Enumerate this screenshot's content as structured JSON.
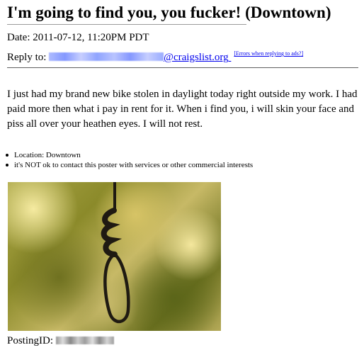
{
  "posting": {
    "title": "I'm going to find you, you fucker! (Downtown)",
    "date_label": "Date:",
    "date_value": "2011-07-12, 11:20PM PDT",
    "reply_label": "Reply to:",
    "reply_domain": "@craigslist.org",
    "errors_link": "[Errors when replying to ads?]",
    "body": "I just had my brand new bike stolen in daylight today right outside my work. I had paid more then what i pay in rent for it. When i find you, i will skin your face and piss all over your heathen eyes. I will not rest.",
    "details": [
      {
        "text": "Location: Downtown"
      },
      {
        "text": "it's NOT ok to contact this poster with services or other commercial interests"
      }
    ],
    "posting_id_label": "PostingID:"
  },
  "colors": {
    "link": "#0000ee",
    "text": "#000000",
    "background": "#ffffff"
  },
  "icons": {
    "bullet": "bullet-dot-icon"
  }
}
